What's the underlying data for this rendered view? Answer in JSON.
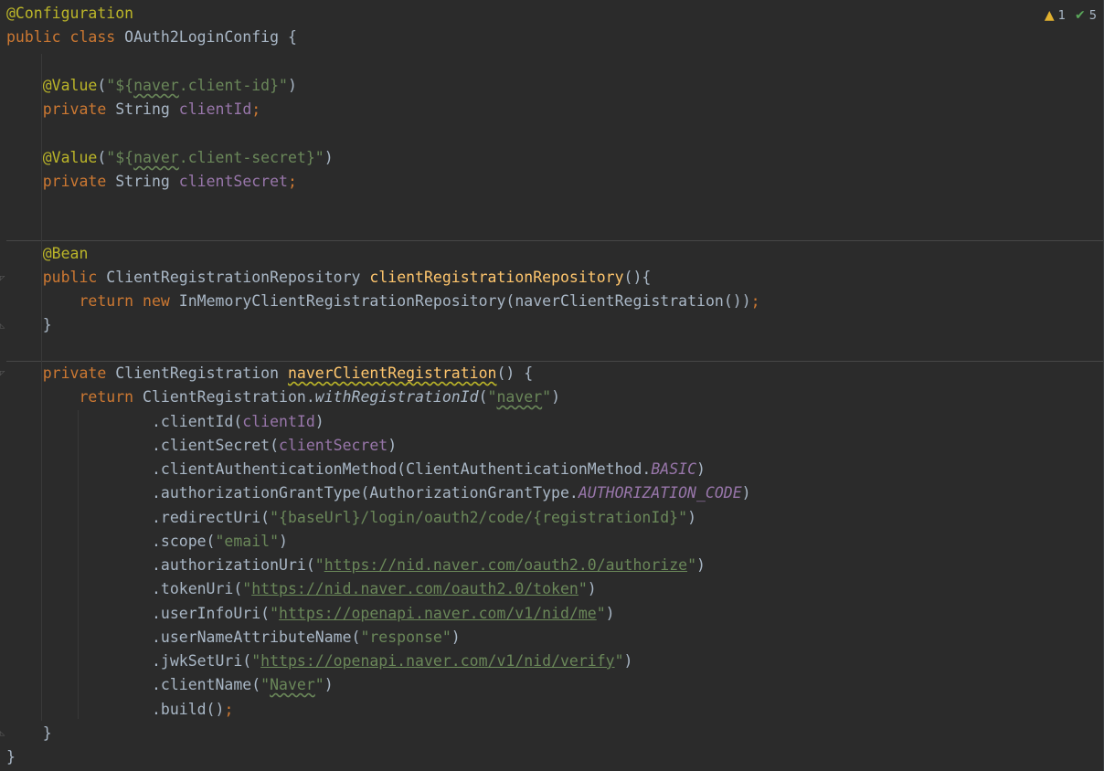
{
  "inspections": {
    "warning_count": "1",
    "weak_warning_count": "5",
    "warning_icon": "warning-triangle-icon",
    "typo_icon": "typo-check-icon"
  },
  "code": {
    "annotation_configuration": "@Configuration",
    "kw_public": "public",
    "kw_class": "class",
    "class_name": "OAuth2LoginConfig",
    "open_brace": " {",
    "annotation_value": "@Value",
    "value_client_id_prefix": "\"${",
    "value_naver": "naver",
    "value_client_id_suffix": ".client-id}\"",
    "value_client_secret_suffix": ".client-secret}\"",
    "kw_private": "private",
    "type_string": "String",
    "field_client_id": "clientId",
    "field_client_secret": "clientSecret",
    "annotation_bean": "@Bean",
    "type_repo": "ClientRegistrationRepository",
    "method_repo": "clientRegistrationRepository",
    "kw_return": "return",
    "kw_new": "new",
    "type_inmemory": "InMemoryClientRegistrationRepository",
    "call_naver_reg": "naverClientRegistration",
    "type_client_registration": "ClientRegistration",
    "method_naver_reg": "naverClientRegistration",
    "static_with_id": "withRegistrationId",
    "naver_string": "naver",
    "chain_client_id": ".clientId(",
    "chain_client_secret": ".clientSecret(",
    "chain_auth_method": ".clientAuthenticationMethod(ClientAuthenticationMethod.",
    "const_basic": "BASIC",
    "chain_grant_type": ".authorizationGrantType(AuthorizationGrantType.",
    "const_auth_code": "AUTHORIZATION_CODE",
    "chain_redirect": ".redirectUri(",
    "redirect_value": "\"{baseUrl}/login/oauth2/code/{registrationId}\"",
    "chain_scope": ".scope(",
    "scope_value": "\"email\"",
    "chain_authorization_uri": ".authorizationUri(",
    "authorization_uri": "https://nid.naver.com/oauth2.0/authorize",
    "chain_token_uri": ".tokenUri(",
    "token_uri": "https://nid.naver.com/oauth2.0/token",
    "chain_user_info_uri": ".userInfoUri(",
    "user_info_uri": "https://openapi.naver.com/v1/nid/me",
    "chain_user_name_attr": ".userNameAttributeName(",
    "user_name_attr": "\"response\"",
    "chain_jwk": ".jwkSetUri(",
    "jwk_uri": "https://openapi.naver.com/v1/nid/verify",
    "chain_client_name": ".clientName(",
    "client_name": "Naver",
    "chain_build": ".build()",
    "semicolon": ";",
    "close_brace": "}"
  }
}
